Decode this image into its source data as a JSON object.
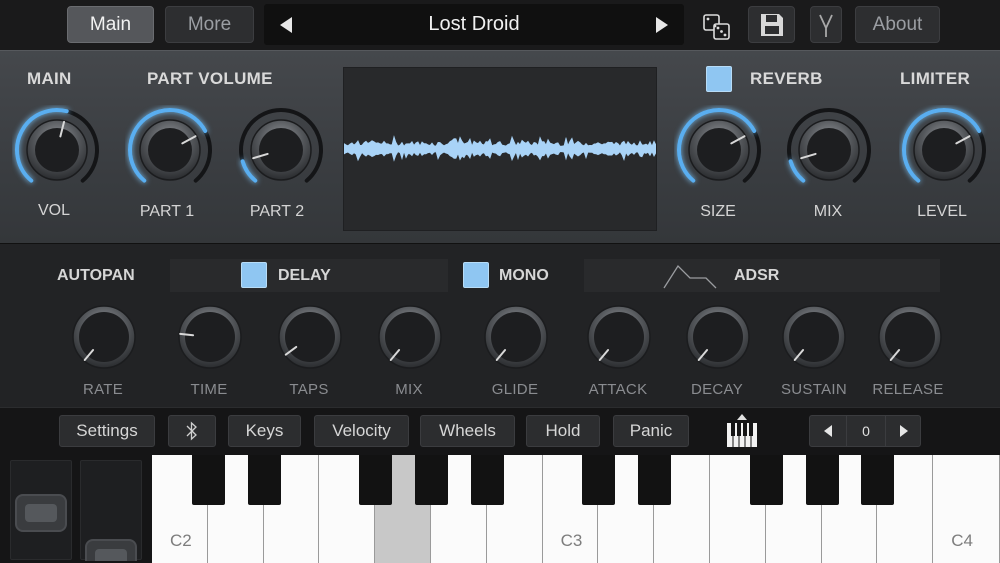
{
  "header": {
    "tabs": [
      {
        "label": "Main",
        "active": true
      },
      {
        "label": "More",
        "active": false
      }
    ],
    "preset_name": "Lost Droid",
    "about_label": "About",
    "icons": [
      "arrow-left-icon",
      "arrow-right-icon",
      "dice-icon",
      "save-icon",
      "fork-icon"
    ]
  },
  "upper": {
    "main_label": "MAIN",
    "part_volume_label": "PART VOLUME",
    "reverb_label": "REVERB",
    "reverb_enabled": true,
    "limiter_label": "LIMITER",
    "knobs": [
      {
        "label": "VOL",
        "level": 0.55
      },
      {
        "label": "PART 1",
        "level": 0.72
      },
      {
        "label": "PART 2",
        "level": 0.12
      },
      {
        "label": "SIZE",
        "level": 0.72
      },
      {
        "label": "MIX",
        "level": 0.12
      },
      {
        "label": "LEVEL",
        "level": 0.72
      }
    ]
  },
  "middle": {
    "autopan_label": "AUTOPAN",
    "delay_label": "DELAY",
    "delay_enabled": true,
    "mono_label": "MONO",
    "mono_enabled": true,
    "adsr_label": "ADSR",
    "knobs": [
      {
        "label": "RATE"
      },
      {
        "label": "TIME"
      },
      {
        "label": "TAPS"
      },
      {
        "label": "MIX"
      },
      {
        "label": "GLIDE"
      },
      {
        "label": "ATTACK"
      },
      {
        "label": "DECAY"
      },
      {
        "label": "SUSTAIN"
      },
      {
        "label": "RELEASE"
      }
    ]
  },
  "keyboard_bar": {
    "buttons": [
      "Settings",
      "Keys",
      "Velocity",
      "Wheels",
      "Hold",
      "Panic"
    ],
    "octave_value": "0",
    "icons": [
      "bluetooth-icon",
      "piano-icon",
      "octave-down-icon",
      "octave-up-icon"
    ]
  },
  "keyboard": {
    "note_labels": [
      "C2",
      "C3",
      "C4"
    ],
    "pressed_key": "G2"
  },
  "colors": {
    "accent": "#7cc3f5",
    "knob_arc": "#5aaef0",
    "checkbox": "#8fc6f2",
    "waveform": "#a9d3f7"
  }
}
